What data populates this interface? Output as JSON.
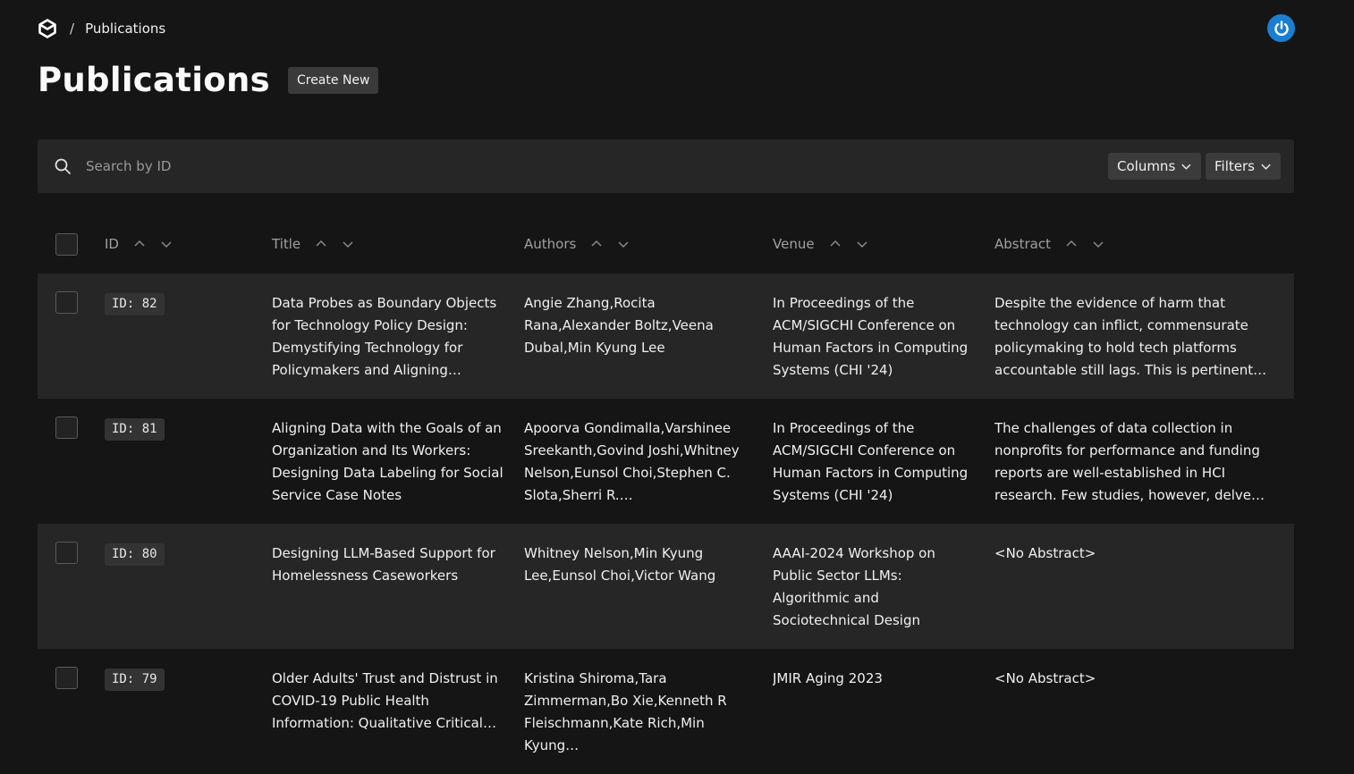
{
  "breadcrumb": {
    "separator": "/",
    "current": "Publications"
  },
  "page_title": "Publications",
  "create_label": "Create New",
  "search": {
    "placeholder": "Search by ID"
  },
  "toolbar": {
    "columns_label": "Columns",
    "filters_label": "Filters"
  },
  "colors": {
    "accent": "#1b7fd1",
    "background": "#151515",
    "row_shade": "#262626"
  },
  "table": {
    "headers": [
      "ID",
      "Title",
      "Authors",
      "Venue",
      "Abstract"
    ],
    "rows": [
      {
        "id": "ID: 82",
        "title": "Data Probes as Boundary Objects for Technology Policy Design: Demystifying Technology for Policymakers and Aligning…",
        "authors": "Angie Zhang,Rocita Rana,Alexander Boltz,Veena Dubal,Min Kyung Lee",
        "venue": "In Proceedings of the ACM/SIGCHI Conference on Human Factors in Computing Systems (CHI '24)",
        "abstract": "Despite the evidence of harm that technology can inflict, commensurate policymaking to hold tech platforms accountable still lags. This is pertinent to…"
      },
      {
        "id": "ID: 81",
        "title": "Aligning Data with the Goals of an Organization and Its Workers: Designing Data Labeling for Social Service Case Notes",
        "authors": "Apoorva Gondimalla,Varshinee Sreekanth,Govind Joshi,Whitney Nelson,Eunsol Choi,Stephen C. Slota,Sherri R. Greenberg,Kennet…",
        "venue": "In Proceedings of the ACM/SIGCHI Conference on Human Factors in Computing Systems (CHI '24)",
        "abstract": "The challenges of data collection in nonprofits for performance and funding reports are well-established in HCI research. Few studies, however, delve into improvin…"
      },
      {
        "id": "ID: 80",
        "title": "Designing LLM-Based Support for Homelessness Caseworkers",
        "authors": "Whitney Nelson,Min Kyung Lee,Eunsol Choi,Victor Wang",
        "venue": "AAAI-2024 Workshop on Public Sector LLMs: Algorithmic and Sociotechnical Design",
        "abstract": "<No Abstract>"
      },
      {
        "id": "ID: 79",
        "title": "Older Adults' Trust and Distrust in COVID-19 Public Health Information: Qualitative Critical…",
        "authors": "Kristina Shiroma,Tara Zimmerman,Bo Xie,Kenneth R Fleischmann,Kate Rich,Min Kyung…",
        "venue": "JMIR Aging 2023",
        "abstract": "<No Abstract>"
      }
    ]
  }
}
